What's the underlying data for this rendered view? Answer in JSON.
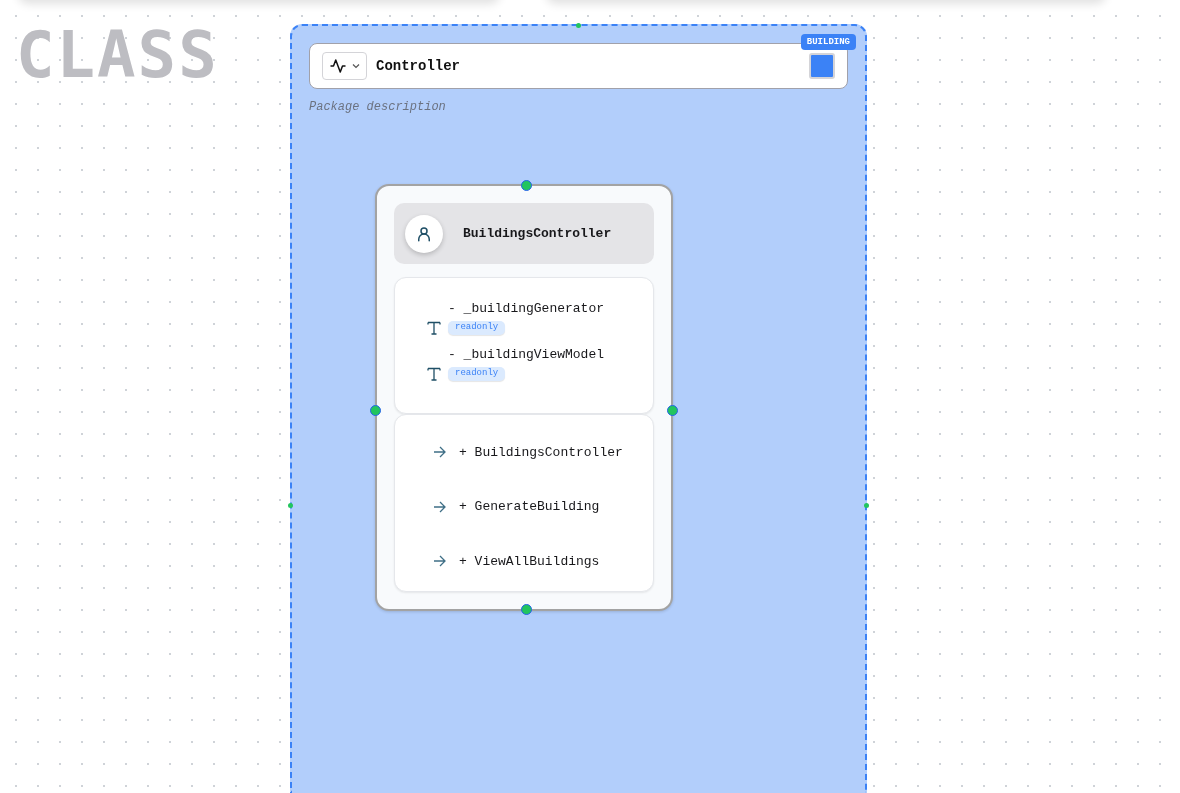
{
  "canvas_label": "CLASS",
  "package": {
    "name": "Controller",
    "badge": "BUILDING",
    "color": "#3b82f6",
    "description": "Package description",
    "class": {
      "name": "BuildingsController",
      "attributes": [
        {
          "name": "- _buildingGenerator",
          "modifier": "readonly"
        },
        {
          "name": "- _buildingViewModel",
          "modifier": "readonly"
        }
      ],
      "methods": [
        {
          "name": "+ BuildingsController"
        },
        {
          "name": "+ GenerateBuilding"
        },
        {
          "name": "+ ViewAllBuildings"
        }
      ]
    }
  }
}
